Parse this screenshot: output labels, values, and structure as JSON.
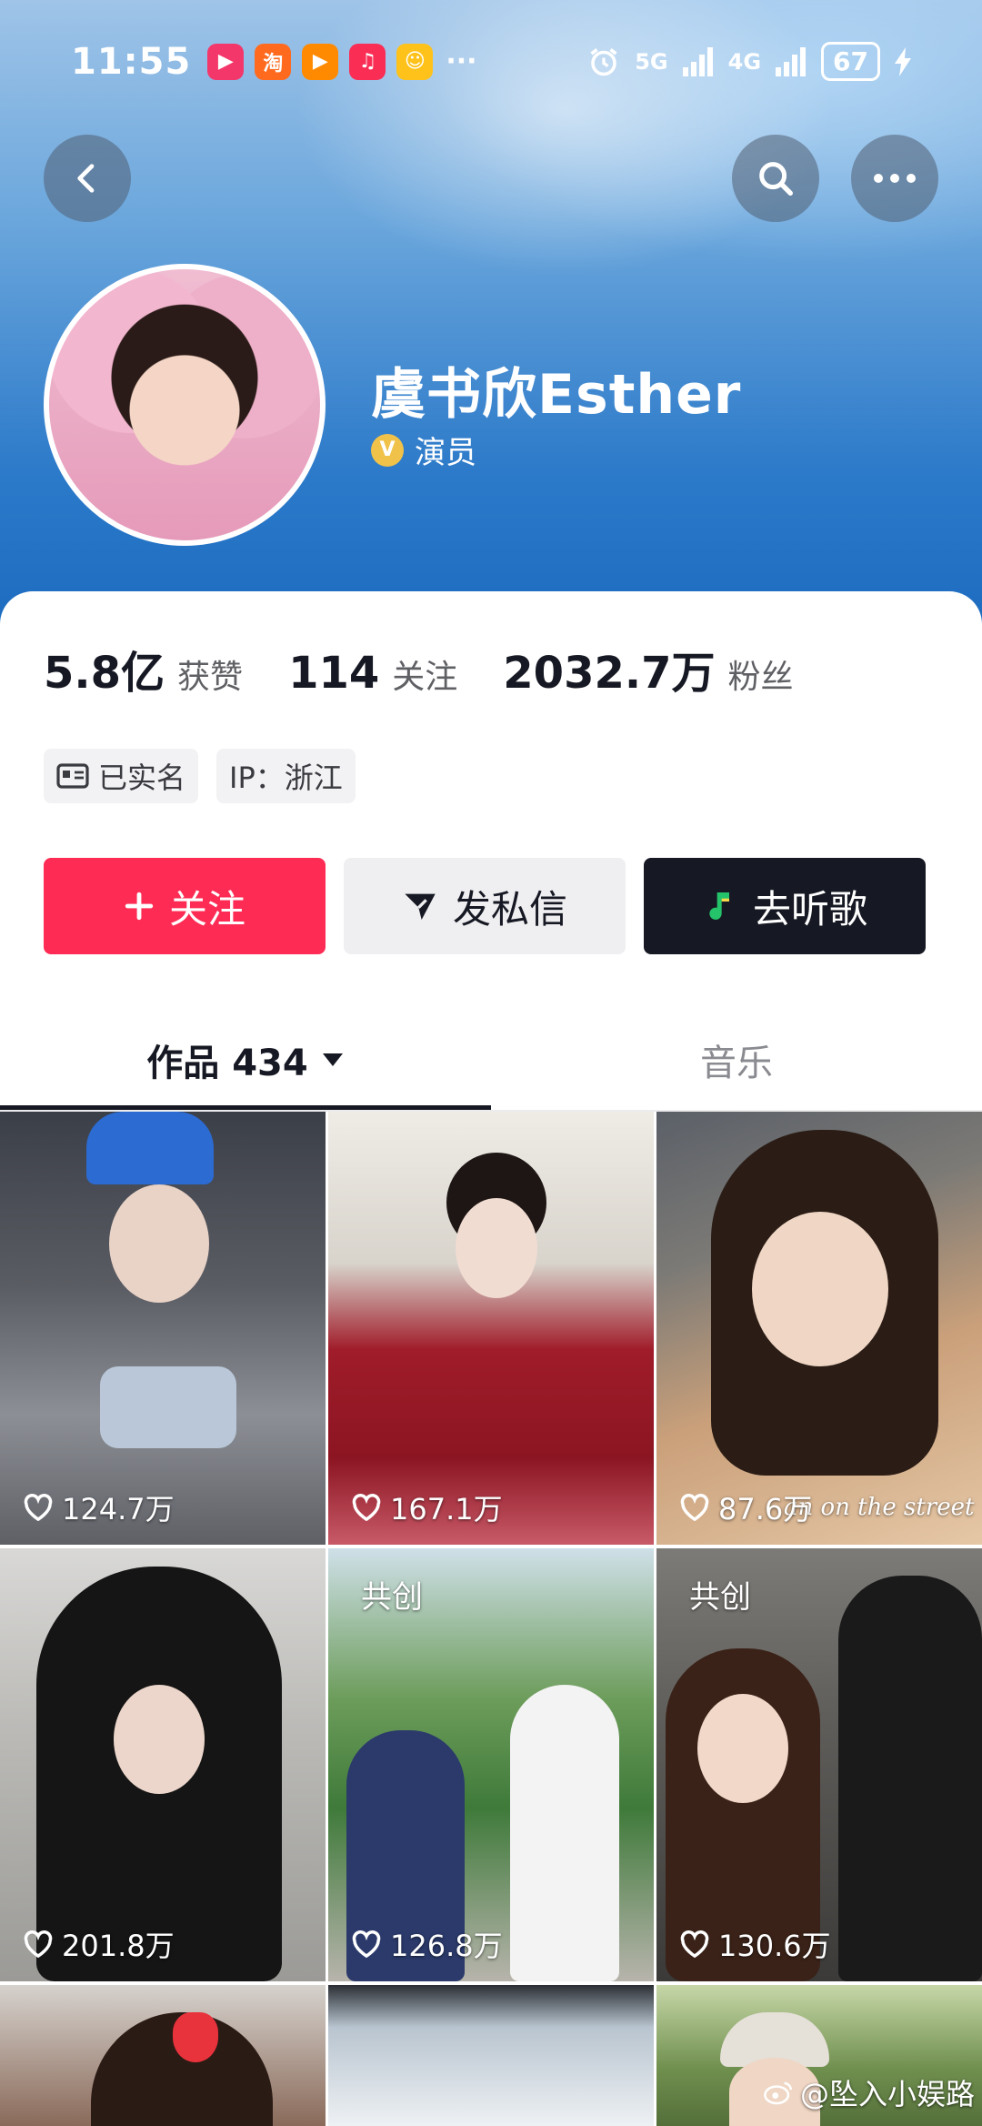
{
  "status_bar": {
    "time": "11:55",
    "apps": [
      {
        "name": "video-app-icon",
        "glyph": "▶",
        "color": "#f4376b"
      },
      {
        "name": "taobao-app-icon",
        "glyph": "淘",
        "color": "#ff6a1f"
      },
      {
        "name": "youku-app-icon",
        "glyph": "▶",
        "color": "#ff8a00"
      },
      {
        "name": "music-app-icon",
        "glyph": "♫",
        "color": "#fa2d55"
      },
      {
        "name": "meituan-app-icon",
        "glyph": "☺",
        "color": "#ffc21a"
      }
    ],
    "more": "···",
    "signal_1": "5G",
    "signal_2": "4G",
    "battery": "67"
  },
  "profile": {
    "name": "虞书欣Esther",
    "verify_badge": "V",
    "verify_label": "演员"
  },
  "stats": [
    {
      "value": "5.8亿",
      "label": "获赞"
    },
    {
      "value": "114",
      "label": "关注"
    },
    {
      "value": "2032.7万",
      "label": "粉丝"
    }
  ],
  "tags": {
    "real_name": "已实名",
    "ip": "IP：浙江"
  },
  "actions": {
    "follow": "关注",
    "message": "发私信",
    "music": "去听歌"
  },
  "tabs": {
    "works": "作品 434",
    "music": "音乐"
  },
  "posts": [
    {
      "likes": "124.7万",
      "badge": "",
      "caption": ""
    },
    {
      "likes": "167.1万",
      "badge": "",
      "caption": ""
    },
    {
      "likes": "87.6万",
      "badge": "",
      "caption": "an on the street"
    },
    {
      "likes": "201.8万",
      "badge": "",
      "caption": ""
    },
    {
      "likes": "126.8万",
      "badge": "共创",
      "caption": ""
    },
    {
      "likes": "130.6万",
      "badge": "共创",
      "caption": ""
    }
  ],
  "watermark": "@坠入小娱路"
}
